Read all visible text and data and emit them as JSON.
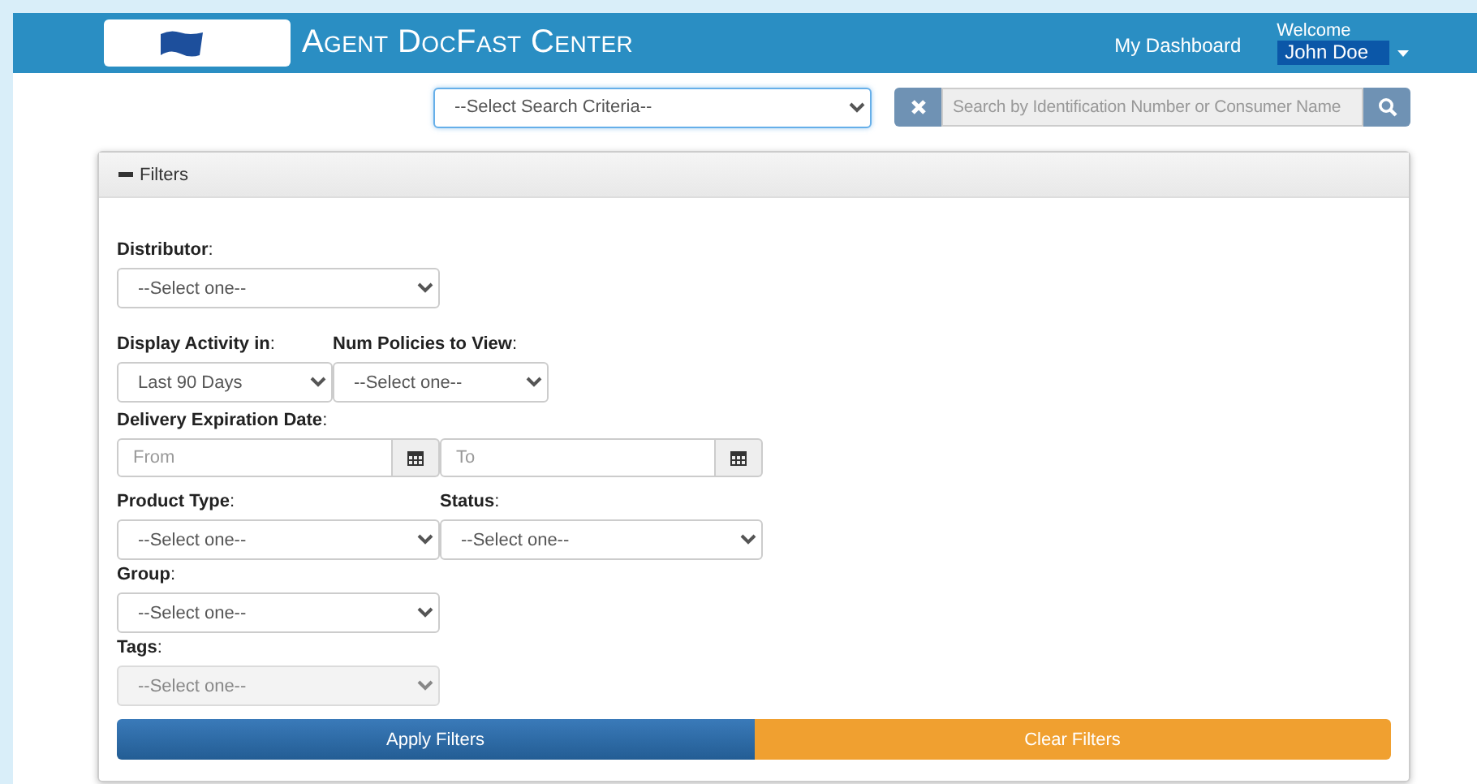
{
  "header": {
    "title": "Agent DocFast Center",
    "dashboard_link": "My Dashboard",
    "welcome": "Welcome",
    "user": "John Doe"
  },
  "search": {
    "criteria": "--Select Search Criteria--",
    "placeholder": "Search by Identification Number or Consumer Name"
  },
  "filters": {
    "title": "Filters",
    "expanded": true,
    "rows": [
      {
        "fields": [
          {
            "kind": "select",
            "label": "**Distributor**:",
            "value": "--Select one--",
            "disabled": false
          }
        ]
      },
      {
        "fields": [
          {
            "kind": "compact-select",
            "label": "**Display Activity in**:",
            "value": "Last 90 Days",
            "disabled": false
          },
          {
            "kind": "compact-select",
            "label": "**Num Policies to View**:",
            "value": "--Select one--",
            "disabled": false
          }
        ]
      },
      {
        "fields": [
          {
            "kind": "date-range",
            "label": "**Delivery Expiration Date**:",
            "from_placeholder": "From",
            "to_placeholder": "To"
          }
        ]
      },
      {
        "fields": [
          {
            "kind": "select",
            "label": "**Product Type**:",
            "value": "--Select one--",
            "disabled": false
          },
          {
            "kind": "select",
            "label": "**Status**:",
            "value": "--Select one--",
            "disabled": false
          }
        ]
      },
      {
        "fields": [
          {
            "kind": "select",
            "label": "**Group**:",
            "value": "--Select one--",
            "disabled": false
          }
        ]
      },
      {
        "fields": [
          {
            "kind": "select",
            "label": "**Tags**:",
            "value": "--Select one--",
            "disabled": true
          }
        ]
      }
    ],
    "buttons": [
      {
        "kind": "primary",
        "label": "Apply Filters"
      },
      {
        "kind": "warning",
        "label": "Clear Filters"
      }
    ]
  }
}
